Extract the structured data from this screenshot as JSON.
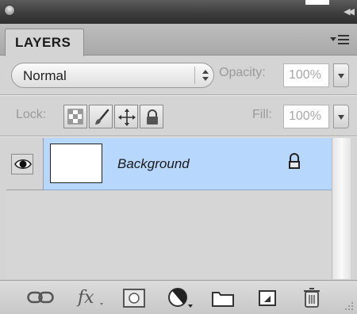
{
  "panel": {
    "tab_label": "LAYERS",
    "blend_mode": "Normal",
    "opacity_label": "Opacity:",
    "opacity_value": "100%",
    "lock_label": "Lock:",
    "fill_label": "Fill:",
    "fill_value": "100%"
  },
  "layers": [
    {
      "name": "Background",
      "visible": true,
      "locked": true,
      "selected": true
    }
  ],
  "lock_buttons": [
    "lock-transparent-pixels-icon",
    "lock-image-pixels-icon",
    "lock-position-icon",
    "lock-all-icon"
  ],
  "bottom_tools": [
    "link-layers-icon",
    "layer-style-fx-icon",
    "add-mask-icon",
    "new-adjustment-layer-icon",
    "new-group-folder-icon",
    "new-layer-icon",
    "delete-layer-trash-icon"
  ],
  "colors": {
    "selected_row": "#b7d7fd",
    "panel_bg": "#d4d4d4",
    "titlebar": "#3c3c3c"
  }
}
